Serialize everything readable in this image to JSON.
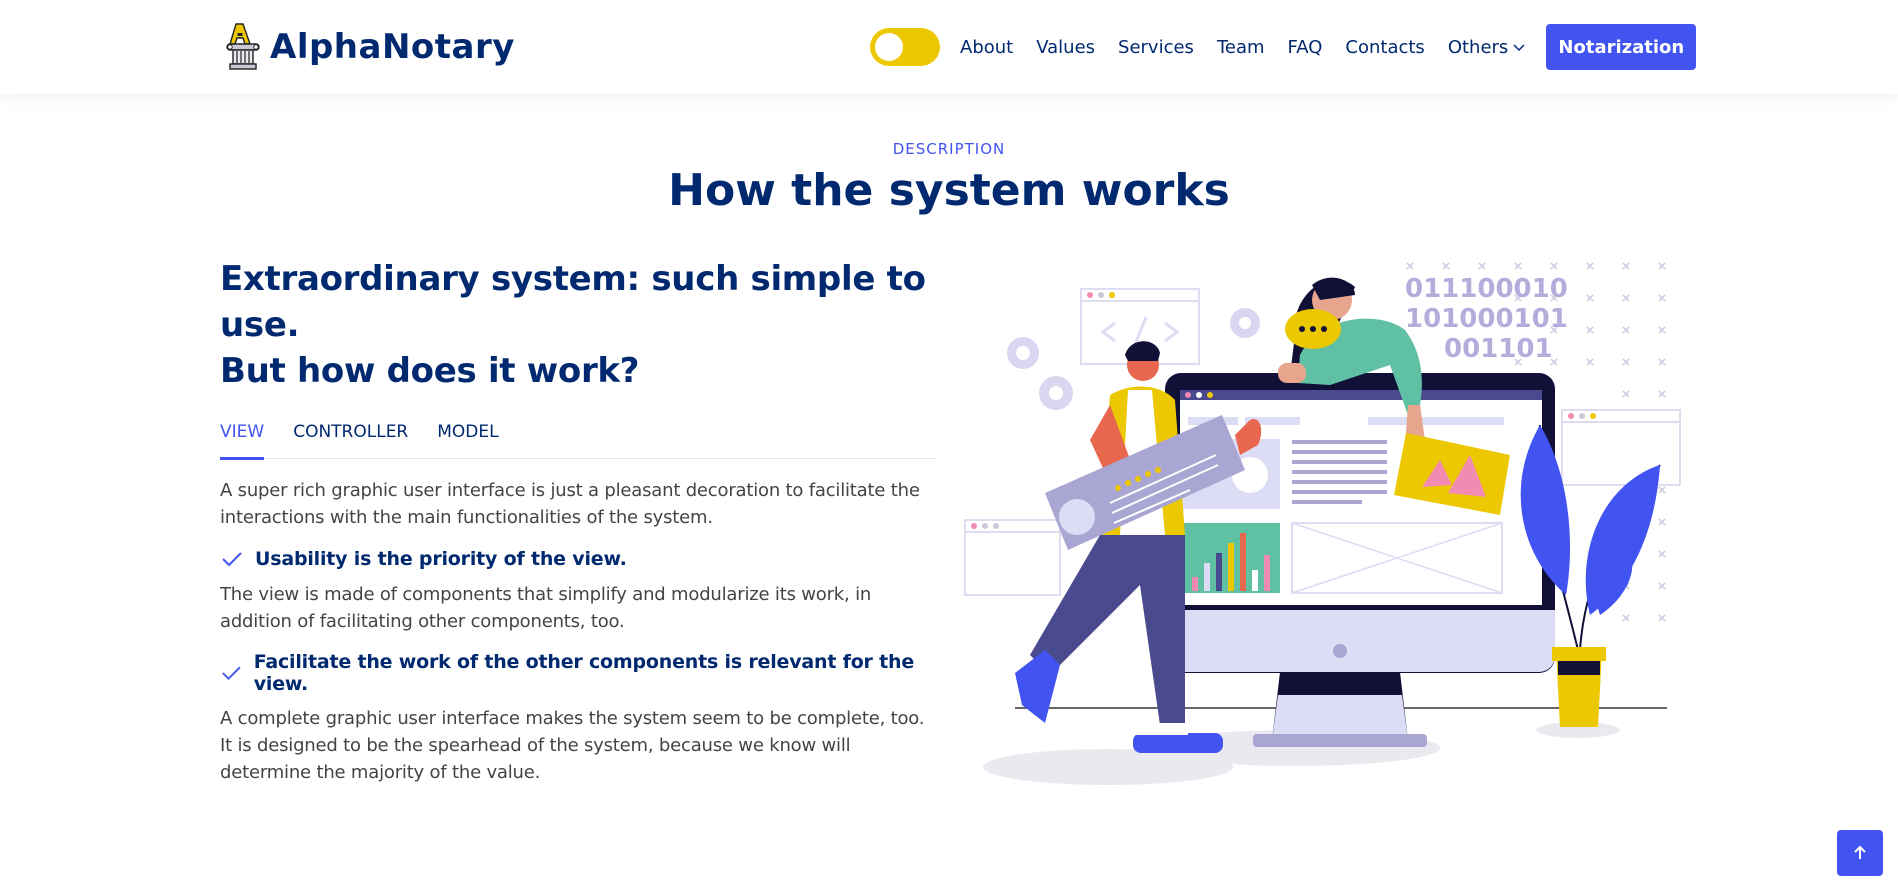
{
  "header": {
    "brand": "AlphaNotary",
    "logo_icon": "notary-pillar-logo-icon",
    "theme_toggle_icon": "theme-toggle",
    "nav": [
      "About",
      "Values",
      "Services",
      "Team",
      "FAQ",
      "Contacts"
    ],
    "dropdown_label": "Others",
    "dropdown_icon": "chevron-down-icon",
    "cta_label": "Notarization"
  },
  "section": {
    "eyebrow": "Description",
    "title": "How the system works"
  },
  "content": {
    "subtitle_line1": "Extraordinary system: such simple to use.",
    "subtitle_line2": "But how does it work?",
    "tabs": [
      "VIEW",
      "CONTROLLER",
      "MODEL"
    ],
    "active_tab": "VIEW",
    "intro": "A super rich graphic user interface is just a pleasant decoration to facilitate the interactions with the main functionalities of the system.",
    "points": [
      {
        "title": "Usability is the priority of the view.",
        "text": "The view is made of components that simplify and modularize its work, in addition of facilitating other components, too."
      },
      {
        "title": "Facilitate the work of the other components is relevant for the view.",
        "text": "A complete graphic user interface makes the system seem to be complete, too. It is designed to be the spearhead of the system, because we know will determine the majority of the value."
      }
    ]
  },
  "illustration": {
    "binary": [
      "011100010",
      "101000101",
      "001101"
    ]
  },
  "back_to_top_icon": "arrow-up-icon",
  "colors": {
    "primary": "#4154f1",
    "navy": "#012970",
    "yellow": "#ecc800",
    "teal": "#5fc0a4",
    "lavender": "#a9a3d6"
  }
}
